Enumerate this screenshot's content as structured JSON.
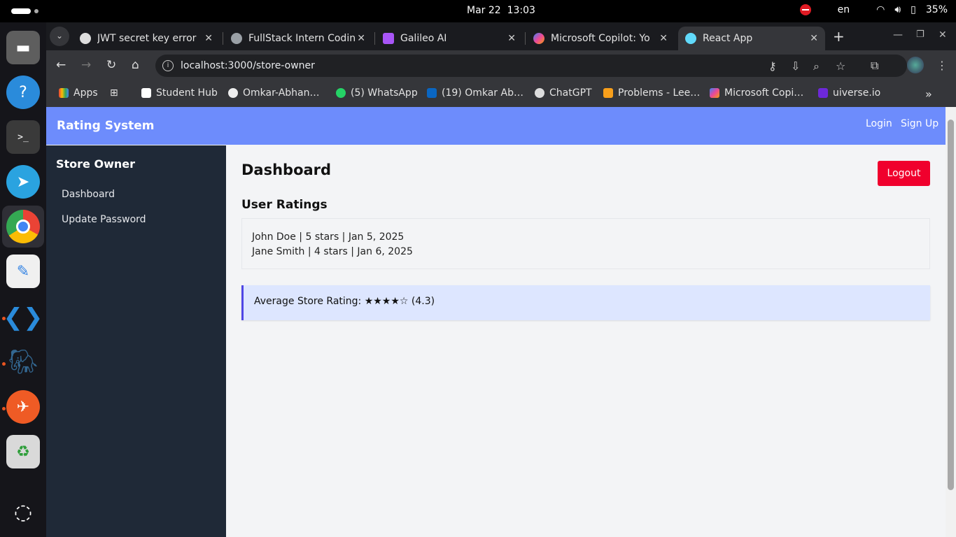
{
  "system": {
    "date": "Mar 22",
    "time": "13:03",
    "lang": "en",
    "battery": "35%"
  },
  "tabs": [
    {
      "title": "JWT secret key error",
      "color": "#dddddd"
    },
    {
      "title": "FullStack Intern Codin",
      "color": "#9aa0a6"
    },
    {
      "title": "Galileo AI",
      "color": "#a855f7"
    },
    {
      "title": "Microsoft Copilot: Yo",
      "color": "#f59e0b"
    },
    {
      "title": "React App",
      "color": "#61dafb"
    }
  ],
  "url": "localhost:3000/store-owner",
  "bookmarks": [
    "Apps",
    "Student Hub",
    "Omkar-Abhan…",
    "(5) WhatsApp",
    "(19) Omkar Ab…",
    "ChatGPT",
    "Problems - Lee…",
    "Microsoft Copi…",
    "uiverse.io"
  ],
  "app": {
    "brand": "Rating System",
    "login": "Login",
    "signup": "Sign Up",
    "sidebar_title": "Store Owner",
    "sidebar_items": [
      "Dashboard",
      "Update Password"
    ],
    "page_title": "Dashboard",
    "logout": "Logout",
    "ratings_title": "User Ratings",
    "ratings": [
      "John Doe | 5 stars | Jan 5, 2025",
      "Jane Smith | 4 stars | Jan 6, 2025"
    ],
    "average": "Average Store Rating: ★★★★☆ (4.3)"
  },
  "colors": {
    "navbar": "#6d8cfc",
    "sidebar": "#1f2937",
    "logout": "#f0002d",
    "avg_bg": "#dde6ff"
  }
}
